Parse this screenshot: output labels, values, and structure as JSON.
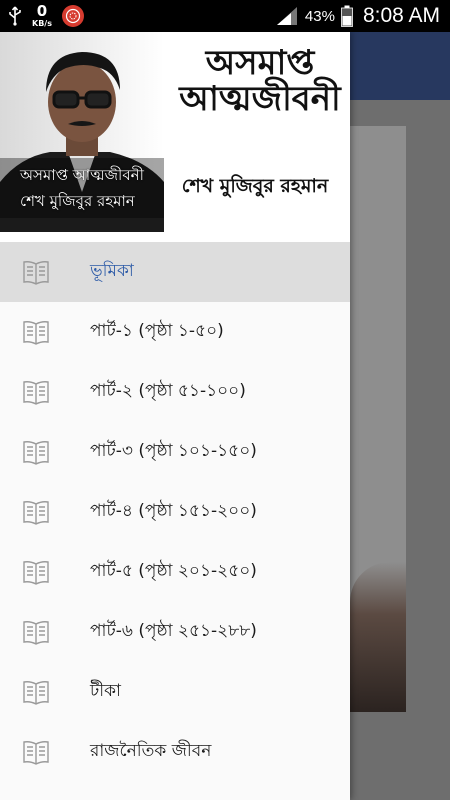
{
  "statusbar": {
    "net_speed_value": "0",
    "net_speed_unit": "KB/s",
    "battery_percent": "43%",
    "time": "8:08 AM"
  },
  "drawer": {
    "header": {
      "book_title": "অসমাপ্ত আত্মজীবনী",
      "book_author": "শেখ মুজিবুর রহমান",
      "overlay_title": "অসমাপ্ত আত্মজীবনী",
      "overlay_author": "শেখ মুজিবুর রহমান"
    },
    "items": [
      {
        "label": "ভূমিকা",
        "active": true
      },
      {
        "label": "পার্ট-১ (পৃষ্ঠা ১-৫০)",
        "active": false
      },
      {
        "label": "পার্ট-২ (পৃষ্ঠা ৫১-১০০)",
        "active": false
      },
      {
        "label": "পার্ট-৩ (পৃষ্ঠা ১০১-১৫০)",
        "active": false
      },
      {
        "label": "পার্ট-৪ (পৃষ্ঠা ১৫১-২০০)",
        "active": false
      },
      {
        "label": "পার্ট-৫ (পৃষ্ঠা ২০১-২৫০)",
        "active": false
      },
      {
        "label": "পার্ট-৬ (পৃষ্ঠা ২৫১-২৮৮)",
        "active": false
      },
      {
        "label": "টীকা",
        "active": false
      },
      {
        "label": "রাজনৈতিক জীবন",
        "active": false
      }
    ]
  },
  "colors": {
    "toolbar": "#27385f",
    "active_item_bg": "#dddddd",
    "active_item_text": "#2c5aa7",
    "icon_stroke": "#9a9a9a"
  },
  "icons": {
    "menu_item": "book-icon"
  }
}
